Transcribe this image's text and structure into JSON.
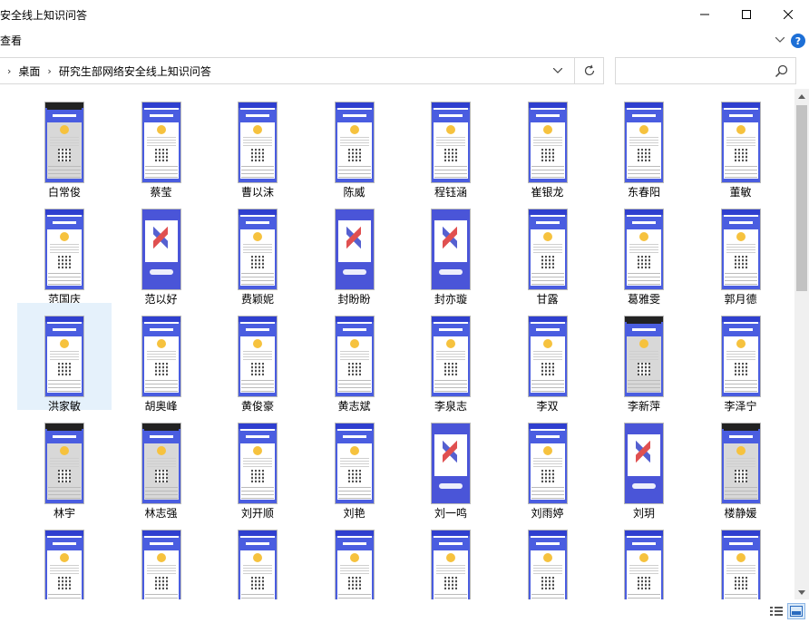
{
  "window": {
    "title": "安全线上知识问答"
  },
  "ribbon": {
    "tab_label": "查看"
  },
  "address": {
    "breadcrumbs": [
      "桌面",
      "研究生部网络安全线上知识问答"
    ]
  },
  "search": {
    "placeholder": ""
  },
  "files": [
    {
      "name": "白常俊",
      "thumb": "dark"
    },
    {
      "name": "蔡莹",
      "thumb": "form"
    },
    {
      "name": "曹以沫",
      "thumb": "form"
    },
    {
      "name": "陈威",
      "thumb": "form"
    },
    {
      "name": "程钰涵",
      "thumb": "form"
    },
    {
      "name": "崔银龙",
      "thumb": "form"
    },
    {
      "name": "东春阳",
      "thumb": "form"
    },
    {
      "name": "董敏",
      "thumb": "form"
    },
    {
      "name": "范国庆",
      "thumb": "form"
    },
    {
      "name": "范以好",
      "thumb": "blue"
    },
    {
      "name": "费颖妮",
      "thumb": "form"
    },
    {
      "name": "封盼盼",
      "thumb": "blue"
    },
    {
      "name": "封亦璇",
      "thumb": "blue"
    },
    {
      "name": "甘露",
      "thumb": "form"
    },
    {
      "name": "葛雅雯",
      "thumb": "form"
    },
    {
      "name": "郭月德",
      "thumb": "form"
    },
    {
      "name": "洪家敏",
      "thumb": "form",
      "selected": true
    },
    {
      "name": "胡奥峰",
      "thumb": "form"
    },
    {
      "name": "黄俊豪",
      "thumb": "form"
    },
    {
      "name": "黄志斌",
      "thumb": "form"
    },
    {
      "name": "李泉志",
      "thumb": "form"
    },
    {
      "name": "李双",
      "thumb": "form"
    },
    {
      "name": "李新萍",
      "thumb": "dark"
    },
    {
      "name": "李泽宁",
      "thumb": "form"
    },
    {
      "name": "林宇",
      "thumb": "dark"
    },
    {
      "name": "林志强",
      "thumb": "dark"
    },
    {
      "name": "刘开顺",
      "thumb": "form"
    },
    {
      "name": "刘艳",
      "thumb": "form"
    },
    {
      "name": "刘一鸣",
      "thumb": "blue"
    },
    {
      "name": "刘雨婷",
      "thumb": "form"
    },
    {
      "name": "刘玥",
      "thumb": "blue"
    },
    {
      "name": "楼静媛",
      "thumb": "dark"
    },
    {
      "name": "",
      "thumb": "form"
    },
    {
      "name": "",
      "thumb": "form"
    },
    {
      "name": "",
      "thumb": "form"
    },
    {
      "name": "",
      "thumb": "form"
    },
    {
      "name": "",
      "thumb": "form"
    },
    {
      "name": "",
      "thumb": "form"
    },
    {
      "name": "",
      "thumb": "form"
    },
    {
      "name": "",
      "thumb": "form"
    }
  ],
  "colors": {
    "accent": "#2f3fcf",
    "selection": "#e5f1fb",
    "help": "#1d6fd6"
  }
}
